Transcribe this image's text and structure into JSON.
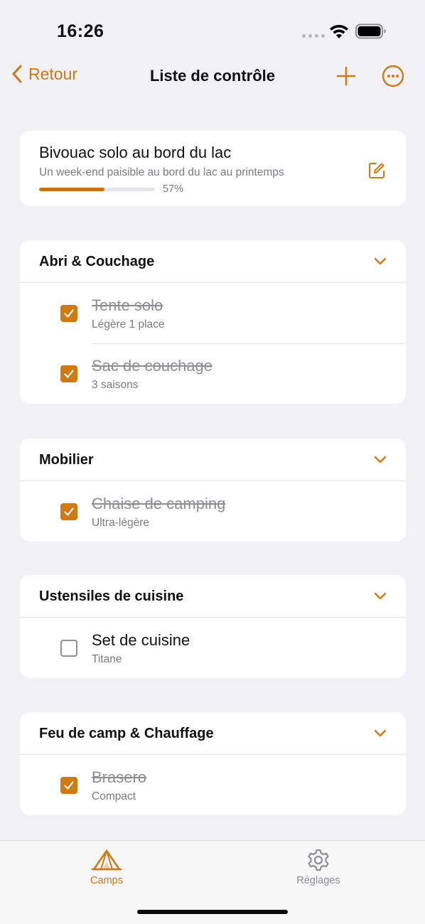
{
  "status": {
    "time": "16:26"
  },
  "nav": {
    "back_label": "Retour",
    "title": "Liste de contrôle"
  },
  "camp": {
    "title": "Bivouac solo au bord du lac",
    "description": "Un week-end paisible au bord du lac au printemps",
    "progress_label": "57%",
    "progress_value": 0.57
  },
  "categories": [
    {
      "title": "Abri & Couchage",
      "items": [
        {
          "name": "Tente solo",
          "sub": "Légère 1 place",
          "checked": true
        },
        {
          "name": "Sac de couchage",
          "sub": "3 saisons",
          "checked": true
        }
      ]
    },
    {
      "title": "Mobilier",
      "items": [
        {
          "name": "Chaise de camping",
          "sub": "Ultra-légère",
          "checked": true
        }
      ]
    },
    {
      "title": "Ustensiles de cuisine",
      "items": [
        {
          "name": "Set de cuisine",
          "sub": "Titane",
          "checked": false
        }
      ]
    },
    {
      "title": "Feu de camp & Chauffage",
      "items": [
        {
          "name": "Brasero",
          "sub": "Compact",
          "checked": true
        }
      ]
    }
  ],
  "tabs": {
    "camps": "Camps",
    "settings": "Réglages"
  },
  "colors": {
    "accent": "#cf7a12",
    "background": "#f2f1f6"
  },
  "icons": [
    "back-chevron-icon",
    "plus-icon",
    "more-icon",
    "edit-icon",
    "chevron-down-icon",
    "tent-icon",
    "gear-icon"
  ]
}
